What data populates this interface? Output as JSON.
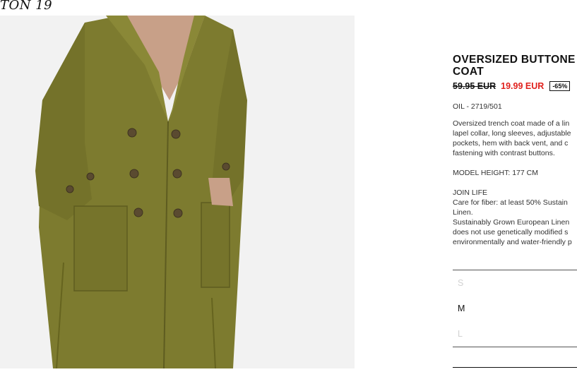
{
  "brand": {
    "logo_fragment": "TON 19"
  },
  "product": {
    "title_line1": "OVERSIZED BUTTONE",
    "title_line2": "COAT",
    "old_price": "59.95 EUR",
    "new_price": "19.99 EUR",
    "discount": "-65%",
    "ref": "OIL - 2719/501",
    "description": [
      "Oversized trench coat made of a lin",
      "lapel collar, long sleeves, adjustable",
      "pockets, hem with back vent, and c",
      "fastening with contrast buttons."
    ],
    "model_height": "MODEL HEIGHT: 177 CM",
    "join_life": [
      "JOIN LIFE",
      "Care for fiber: at least 50% Sustain",
      "Linen.",
      "Sustainably Grown European Linen",
      "does not use genetically modified s",
      "environmentally and water-friendly p"
    ]
  },
  "sizes": [
    {
      "label": "S",
      "available": false
    },
    {
      "label": "M",
      "available": true
    },
    {
      "label": "L",
      "available": false
    }
  ],
  "colors": {
    "price_red": "#e0201c",
    "coat": "#7c7a2e"
  }
}
